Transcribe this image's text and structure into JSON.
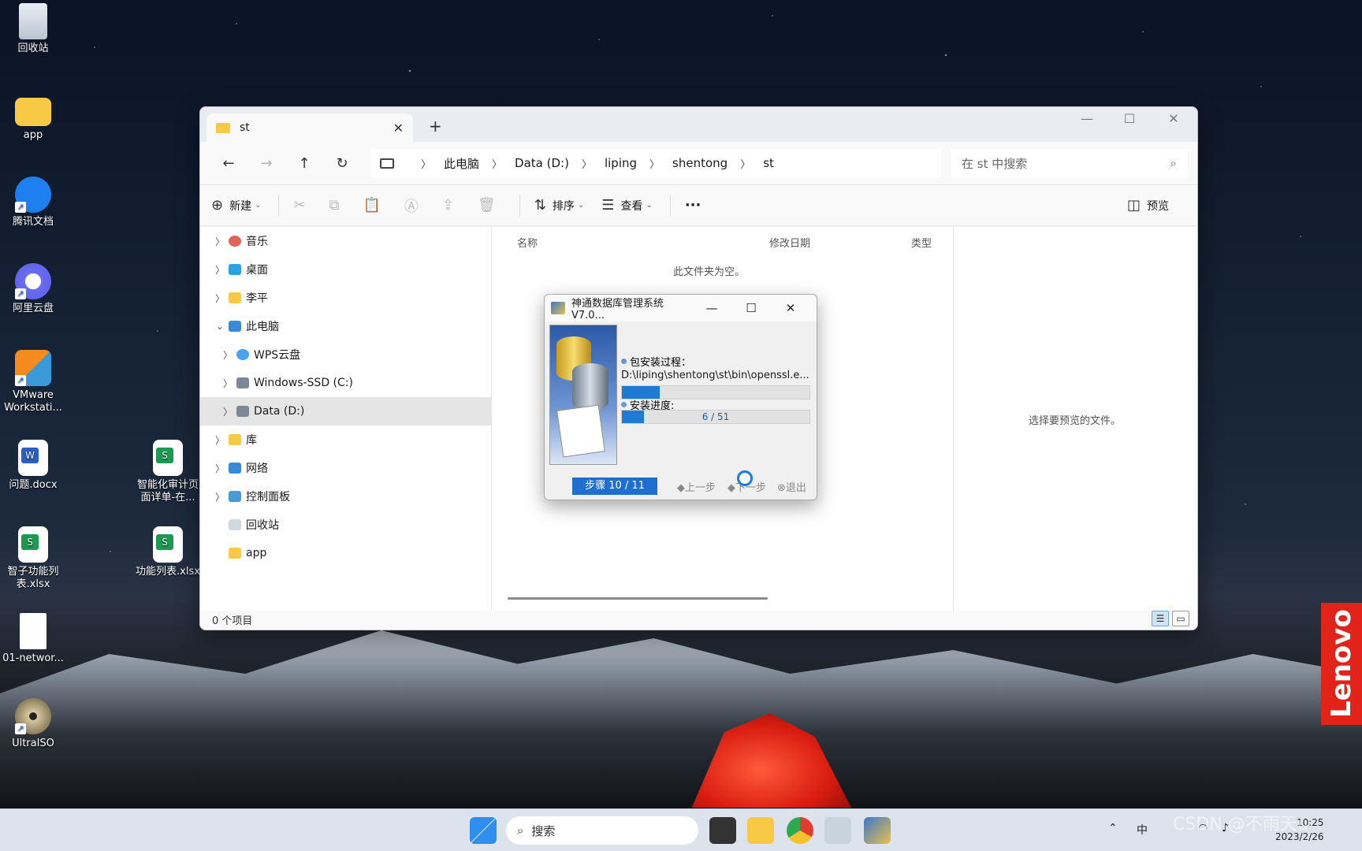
{
  "desktop": {
    "icons": [
      {
        "label": "回收站"
      },
      {
        "label": "app"
      },
      {
        "label": "腾讯文档"
      },
      {
        "label": "阿里云盘"
      },
      {
        "label": "VMware Workstati..."
      },
      {
        "label": "问题.docx"
      },
      {
        "label": "智能化审计页面详单-在..."
      },
      {
        "label": "智子功能列表.xlsx"
      },
      {
        "label": "功能列表.xlsx"
      },
      {
        "label": "01-networ..."
      },
      {
        "label": "UltraISO"
      }
    ],
    "lenovo": "Lenovo"
  },
  "explorer": {
    "tab_title": "st",
    "new_tab": "+",
    "breadcrumb": [
      "此电脑",
      "Data (D:)",
      "liping",
      "shentong",
      "st"
    ],
    "search_placeholder": "在 st 中搜索",
    "toolbar": {
      "new": "新建",
      "sort": "排序",
      "view": "查看",
      "more": "···",
      "preview": "预览"
    },
    "nav": [
      {
        "label": "音乐"
      },
      {
        "label": "桌面"
      },
      {
        "label": "李平"
      },
      {
        "label": "此电脑"
      },
      {
        "label": "WPS云盘"
      },
      {
        "label": "Windows-SSD (C:)"
      },
      {
        "label": "Data (D:)"
      },
      {
        "label": "库"
      },
      {
        "label": "网络"
      },
      {
        "label": "控制面板"
      },
      {
        "label": "回收站"
      },
      {
        "label": "app"
      }
    ],
    "columns": [
      "名称",
      "修改日期",
      "类型"
    ],
    "empty_text": "此文件夹为空。",
    "preview_text": "选择要预览的文件。",
    "status": "0 个项目"
  },
  "installer": {
    "title": "神通数据库管理系统V7.0...",
    "label_process": "包安装过程：",
    "path": "D:\\liping\\shentong\\st\\bin\\openssl.e...",
    "process_progress": 0.2,
    "label_progress": "安装进度:",
    "progress_text": "6 / 51",
    "progress_value": 0.118,
    "step": "步骤 10 / 11",
    "prev": "上一步",
    "next": "下一步",
    "exit": "退出"
  },
  "taskbar": {
    "search": "搜索",
    "ime": "中",
    "time": "10:25",
    "date": "2023/2/26"
  },
  "watermark": "CSDN @不雨天u"
}
